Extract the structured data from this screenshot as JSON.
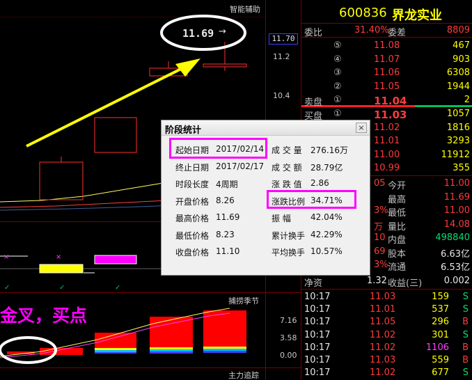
{
  "chart": {
    "main_title": "智能辅助",
    "price_tag": "11.70",
    "y_labels": [
      "11.2",
      "10.4"
    ],
    "callout_price": "11.69",
    "callout_arrow": "→",
    "overlay_text": "金叉，买点",
    "indicator1_title": "捕捞季节",
    "indicator1_labels": [
      "7.16",
      "3.58",
      "0.00"
    ],
    "indicator2_title": "主力追踪",
    "marker_x": "×",
    "marker_check": "✓"
  },
  "quote": {
    "code": "600836",
    "name": "界龙实业",
    "weibi_label": "委比",
    "weibi_value": "31.40%",
    "weicha_label": "委差",
    "weicha_value": "8809",
    "sell_label": "卖盘",
    "buy_label": "买盘",
    "asks": [
      {
        "level": "⑤",
        "price": "11.08",
        "vol": "467"
      },
      {
        "level": "④",
        "price": "11.07",
        "vol": "903"
      },
      {
        "level": "③",
        "price": "11.06",
        "vol": "6308"
      },
      {
        "level": "②",
        "price": "11.05",
        "vol": "1944"
      },
      {
        "level": "①",
        "price": "11.04",
        "vol": "2"
      }
    ],
    "bids": [
      {
        "level": "①",
        "price": "11.03",
        "vol": "1057"
      },
      {
        "level": "②",
        "price": "11.02",
        "vol": "1816"
      },
      {
        "level": "③",
        "price": "11.01",
        "vol": "3293"
      },
      {
        "level": "④",
        "price": "11.00",
        "vol": "11912"
      },
      {
        "level": "⑤",
        "price": "10.99",
        "vol": "355"
      }
    ],
    "stats": [
      {
        "left": "05",
        "label": "今开",
        "value": "11.00"
      },
      {
        "left": "",
        "label": "最高",
        "value": "11.69"
      },
      {
        "left": "3%",
        "label": "最低",
        "value": "11.00"
      },
      {
        "left": "万",
        "label": "量比",
        "value": "14.08"
      },
      {
        "left": "10",
        "label": "内盘",
        "value": "498840"
      },
      {
        "left": "69",
        "label": "股本",
        "value": "6.63亿"
      },
      {
        "left": "3%",
        "label": "流通",
        "value": "6.53亿"
      }
    ],
    "jingzi_label": "净资",
    "jingzi_value": "1.32",
    "shouyi_label": "收益(三)",
    "shouyi_value": "0.002",
    "ticks": [
      {
        "time": "10:17",
        "price": "11.03",
        "vol": "159",
        "side": "S"
      },
      {
        "time": "10:17",
        "price": "11.01",
        "vol": "537",
        "side": "S"
      },
      {
        "time": "10:17",
        "price": "11.05",
        "vol": "296",
        "side": "B"
      },
      {
        "time": "10:17",
        "price": "11.02",
        "vol": "301",
        "side": "S"
      },
      {
        "time": "10:17",
        "price": "11.02",
        "vol": "1106",
        "side": "B"
      },
      {
        "time": "10:17",
        "price": "11.03",
        "vol": "559",
        "side": "B"
      },
      {
        "time": "10:17",
        "price": "11.02",
        "vol": "677",
        "side": "S"
      }
    ]
  },
  "dialog": {
    "title": "阶段统计",
    "close": "×",
    "left_labels": [
      "起始日期",
      "终止日期",
      "时段长度",
      "开盘价格",
      "最高价格",
      "最低价格",
      "收盘价格"
    ],
    "left_values": [
      "2017/02/14",
      "2017/02/17",
      "4周期",
      "8.26",
      "11.69",
      "8.23",
      "11.10"
    ],
    "right_labels": [
      "成 交 量",
      "成 交 额",
      "涨 跌 值",
      "涨跌比例",
      "振    幅",
      "累计换手",
      "平均换手"
    ],
    "right_values": [
      "276.16万",
      "28.79亿",
      "2.86",
      "34.71%",
      "42.04%",
      "42.29%",
      "10.57%"
    ]
  }
}
